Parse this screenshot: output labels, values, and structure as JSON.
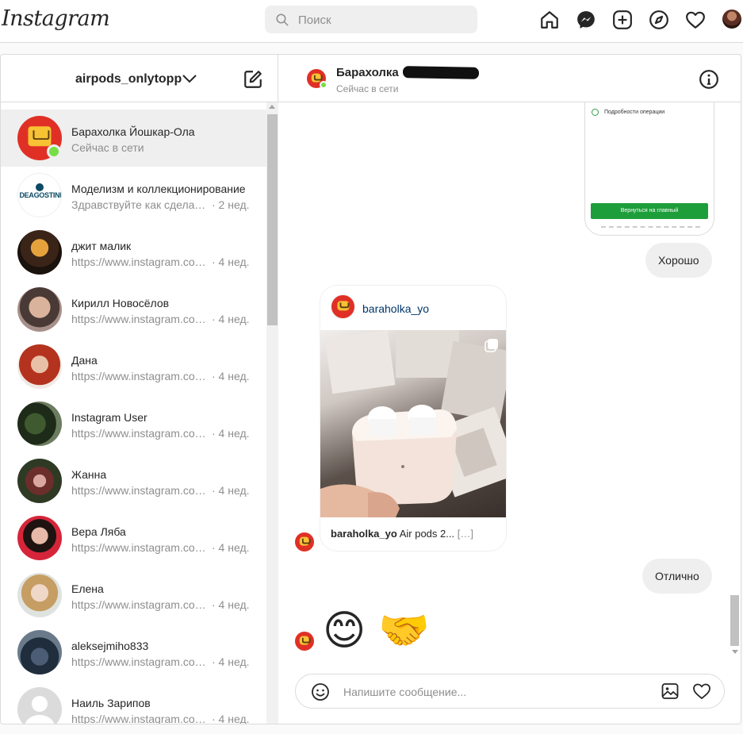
{
  "nav": {
    "logo": "Instagram",
    "search_placeholder": "Поиск",
    "icons": [
      "home-icon",
      "messenger-icon",
      "new-post-icon",
      "explore-icon",
      "heart-icon",
      "profile-avatar"
    ]
  },
  "inbox": {
    "account": "airpods_onlytopp",
    "conversations": [
      {
        "name": "Барахолка Йошкар-Ола",
        "sub": "Сейчас в сети",
        "time": "",
        "active": true,
        "online": true
      },
      {
        "name": "Моделизм и коллекционирование",
        "sub": "Здравствуйте как сделать…",
        "time": "· 2 нед."
      },
      {
        "name": "джит малик",
        "sub": "https://www.instagram.co…",
        "time": "· 4 нед."
      },
      {
        "name": "Кирилл Новосёлов",
        "sub": "https://www.instagram.co…",
        "time": "· 4 нед."
      },
      {
        "name": "Дана",
        "sub": "https://www.instagram.co…",
        "time": "· 4 нед."
      },
      {
        "name": "Instagram User",
        "sub": "https://www.instagram.co…",
        "time": "· 4 нед."
      },
      {
        "name": "Жанна",
        "sub": "https://www.instagram.co…",
        "time": "· 4 нед."
      },
      {
        "name": "Вера Ляба",
        "sub": "https://www.instagram.co…",
        "time": "· 4 нед."
      },
      {
        "name": "Елена",
        "sub": "https://www.instagram.co…",
        "time": "· 4 нед."
      },
      {
        "name": "aleksejmiho833",
        "sub": "https://www.instagram.co…",
        "time": "· 4 нед."
      },
      {
        "name": "Наиль Зарипов",
        "sub": "https://www.instagram.co…",
        "time": "· 4 нед."
      }
    ]
  },
  "chat": {
    "title": "Барахолка",
    "status": "Сейчас в сети",
    "screenshot_row": "Подробности операции",
    "screenshot_button": "Вернуться на главный",
    "msg_good": "Хорошо",
    "post_user": "baraholka_yo",
    "post_caption_user": "baraholka_yo",
    "post_caption_text": " Air pods 2...",
    "post_caption_more": " […]",
    "msg_excellent": "Отлично",
    "emoji_1": "😊",
    "emoji_2": "🤝",
    "composer_placeholder": "Напишите сообщение..."
  },
  "colors": {
    "accent_link": "#00376b",
    "online": "#78de45",
    "muted": "#8e8e8e",
    "border": "#dbdbdb"
  }
}
